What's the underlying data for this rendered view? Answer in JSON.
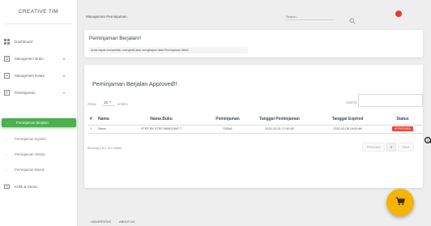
{
  "brand": "CREATIVE TIM",
  "sidebar": {
    "items": [
      {
        "label": "Dashboard",
        "icon": "dashboard-icon"
      },
      {
        "label": "Manajemen Buku",
        "icon": "book-icon",
        "caret": "▾"
      },
      {
        "label": "Manajemen Kelas",
        "icon": "class-icon",
        "caret": "▾"
      },
      {
        "label": "Peminjaman",
        "icon": "loan-icon",
        "caret": "▾"
      }
    ],
    "subitems": [
      {
        "label": "Peminjaman Berjalan",
        "active": true
      },
      {
        "label": "Peminjaman Expired",
        "active": false
      },
      {
        "label": "Peminjaman History",
        "active": false
      },
      {
        "label": "Peminjaman Masuk",
        "active": false
      }
    ],
    "kritik": {
      "label": "Kritik & Saran",
      "icon": "feedback-icon"
    }
  },
  "header": {
    "title": "Manajemen Peminjaman",
    "search_placeholder": "Search..."
  },
  "notice": {
    "title": "Peminjaman Berjalan!!",
    "text": "Anda dapat menambah, mengedit atau menghapus data Peminjaman disini!"
  },
  "approved": {
    "title": "Peminjaman Berjalan Approved!!",
    "show_label": "Show",
    "show_value": "10",
    "entries_label": "entries",
    "search_label": "Search:",
    "columns": [
      "#",
      "Nama",
      "Nama Buku",
      "Peminjaman",
      "Tanggal Peminjaman",
      "Tanggal Expired",
      "Status"
    ],
    "rows": [
      [
        "1",
        "Sisna",
        "STEP BY STEP WINDOWS 7",
        "SISNA",
        "2021-02-01 17:40:18",
        "2021-02-08 19:00:##",
        "APPROVED"
      ]
    ],
    "info": "Showing 1 to 1 of 1 entries",
    "pager": {
      "previous": "Previous",
      "current": "1",
      "next": "Next"
    },
    "annotation_number": "1"
  },
  "footer": {
    "links": [
      "UNIVERSITAS",
      "ABOUT US"
    ]
  },
  "colors": {
    "accent": "#4caf50",
    "badge": "#f44336",
    "fab": "#f5b400",
    "notif": "#e53935"
  }
}
